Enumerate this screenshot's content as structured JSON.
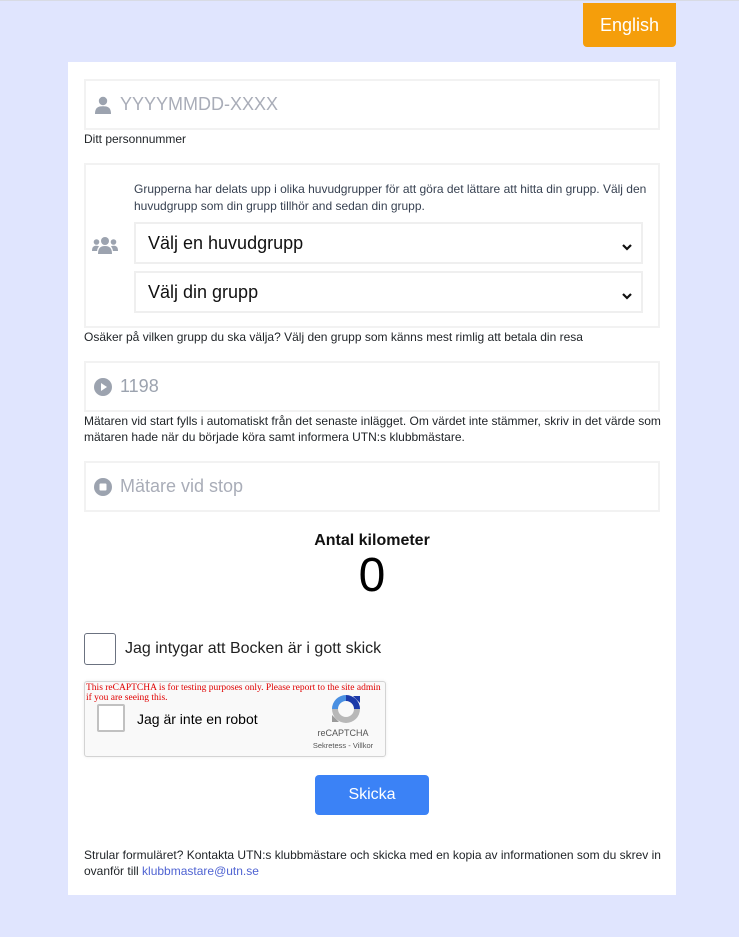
{
  "header": {
    "language_button": "English"
  },
  "form": {
    "personnummer": {
      "icon": "user-icon",
      "placeholder": "YYYYMMDD-XXXX",
      "value": "",
      "help": "Ditt personnummer"
    },
    "group": {
      "icon": "users-icon",
      "description": "Grupperna har delats upp i olika huvudgrupper för att göra det lättare att hitta din grupp. Välj den huvudgrupp som din grupp tillhör and sedan din grupp.",
      "main_group_select": {
        "selected": "Välj en huvudgrupp"
      },
      "group_select": {
        "selected": "Välj din grupp"
      },
      "help": "Osäker på vilken grupp du ska välja? Välj den grupp som känns mest rimlig att betala din resa"
    },
    "meter_start": {
      "icon": "play-circle-icon",
      "value": "1198",
      "help": "Mätaren vid start fylls i automatiskt från det senaste inlägget. Om värdet inte stämmer, skriv in det värde som mätaren hade när du började köra samt informera UTN:s klubbmästare."
    },
    "meter_stop": {
      "icon": "stop-circle-icon",
      "placeholder": "Mätare vid stop",
      "value": ""
    },
    "kilometers": {
      "title": "Antal kilometer",
      "value": "0"
    },
    "certify": {
      "label": "Jag intygar att Bocken är i gott skick",
      "checked": false
    },
    "recaptcha": {
      "warning": "This reCAPTCHA is for testing purposes only. Please report to the site admin if you are seeing this.",
      "label": "Jag är inte en robot",
      "brand": "reCAPTCHA",
      "privacy_link": "Sekretess",
      "separator": " - ",
      "terms_link": "Villkor",
      "checked": false
    },
    "submit_button": "Skicka"
  },
  "footer": {
    "text": "Strular formuläret? Kontakta UTN:s klubbmästare och skicka med en kopia av informationen som du skrev in ovanför till ",
    "email_link": "klubbmastare@utn.se"
  },
  "colors": {
    "page_background": "#e0e5fe",
    "language_button": "#f59e0b",
    "submit_button": "#3b82f6",
    "link": "#4f63d2",
    "icon_gray": "#9ca3af",
    "captcha_warning": "#e00000"
  }
}
